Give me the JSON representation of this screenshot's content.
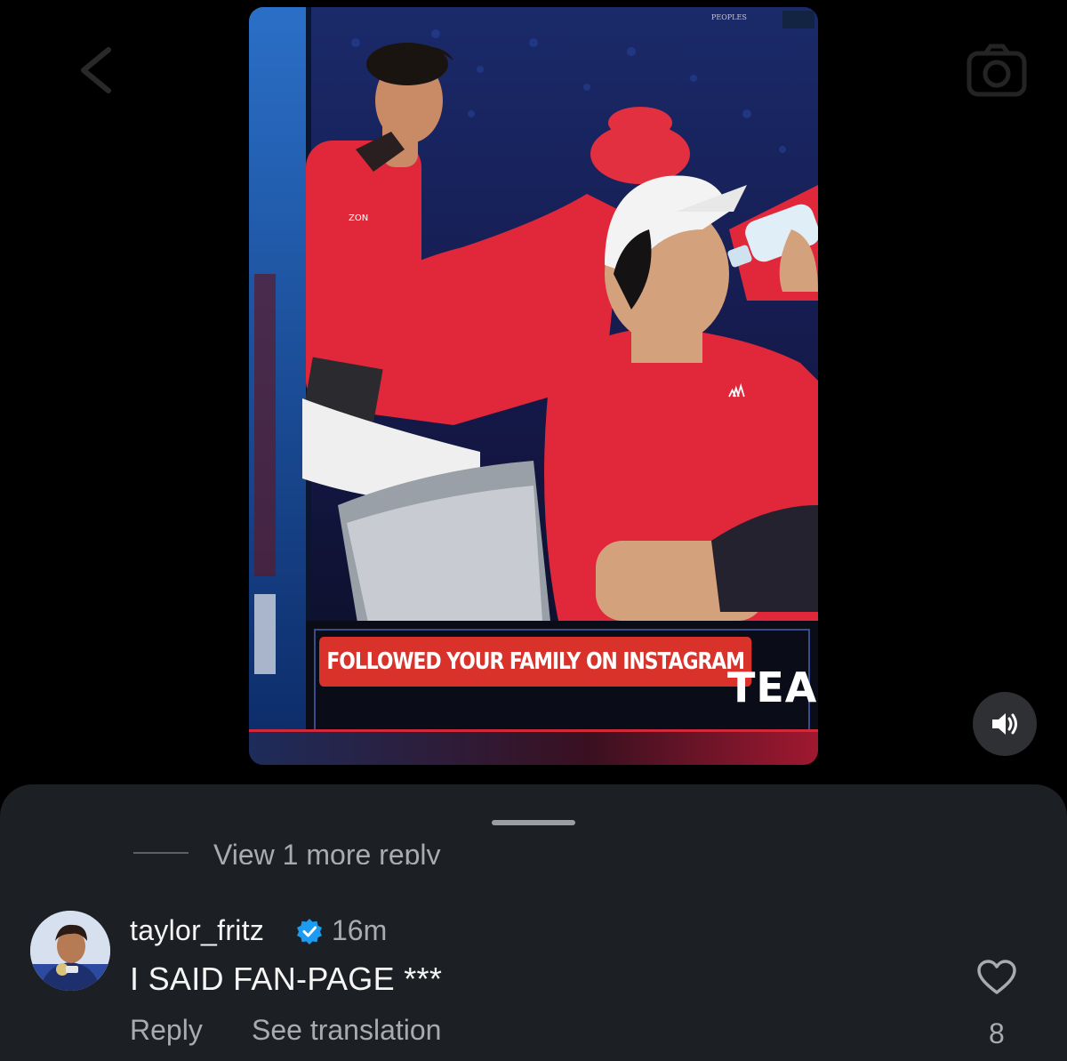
{
  "video": {
    "caption": "FOLLOWED YOUR FAMILY ON INSTAGRAM",
    "corner_text": "TEAI",
    "shirt_mark": "ZON",
    "sponsor_text": "PEOPLES",
    "sound_state": "unmuted"
  },
  "icons": {
    "back": "chevron-left-icon",
    "camera": "camera-icon",
    "sound": "speaker-icon",
    "verified": "verified-badge-icon",
    "like": "heart-icon"
  },
  "comments": {
    "view_more_replies": "View 1 more reply",
    "items": [
      {
        "username": "taylor_fritz",
        "verified": true,
        "time": "16m",
        "text": "I SAID FAN-PAGE ***",
        "reply_label": "Reply",
        "translate_label": "See translation",
        "likes": "8"
      }
    ]
  },
  "colors": {
    "caption_bg": "#d8322a",
    "verified": "#1d9bf0",
    "sheet_bg": "#1c1f23",
    "jersey_red": "#e0283a"
  }
}
